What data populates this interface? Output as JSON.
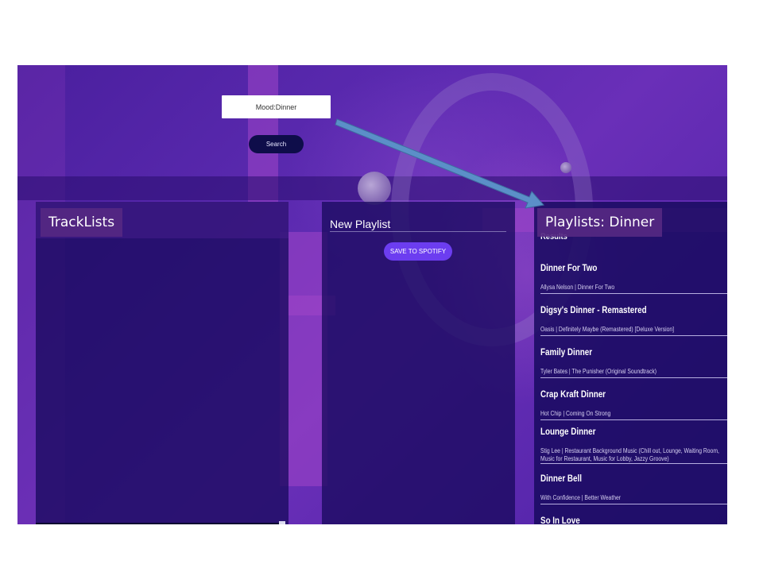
{
  "search": {
    "value": "Mood:Dinner",
    "button_label": "Search"
  },
  "tracklists": {
    "label": "TrackLists"
  },
  "new_playlist": {
    "title_value": "New Playlist",
    "save_label": "SAVE TO SPOTIFY"
  },
  "playlists": {
    "label": "Playlists:  Dinner",
    "results_heading": "Results",
    "tracks": [
      {
        "title": "Dinner For Two",
        "meta": "Allysa Nelson | Dinner For Two"
      },
      {
        "title": "Digsy's Dinner - Remastered",
        "meta": "Oasis | Definitely Maybe (Remastered) [Deluxe Version]"
      },
      {
        "title": "Family Dinner",
        "meta": "Tyler Bates | The Punisher (Original Soundtrack)"
      },
      {
        "title": "Crap Kraft Dinner",
        "meta": "Hot Chip | Coming On Strong"
      },
      {
        "title": "Lounge Dinner",
        "meta": "Stig Lee | Restaurant Background Music (Chill out, Lounge, Waiting Room, Music for Restaurant, Music for Lobby, Jazzy Groove)"
      },
      {
        "title": "Dinner Bell",
        "meta": "With Confidence | Better Weather"
      },
      {
        "title": "So In Love",
        "meta": ""
      }
    ]
  },
  "colors": {
    "accent": "#6c3df0",
    "search_button": "#0e0d4a",
    "label_bg": "#552882",
    "arrow": "#5b8fc8"
  }
}
